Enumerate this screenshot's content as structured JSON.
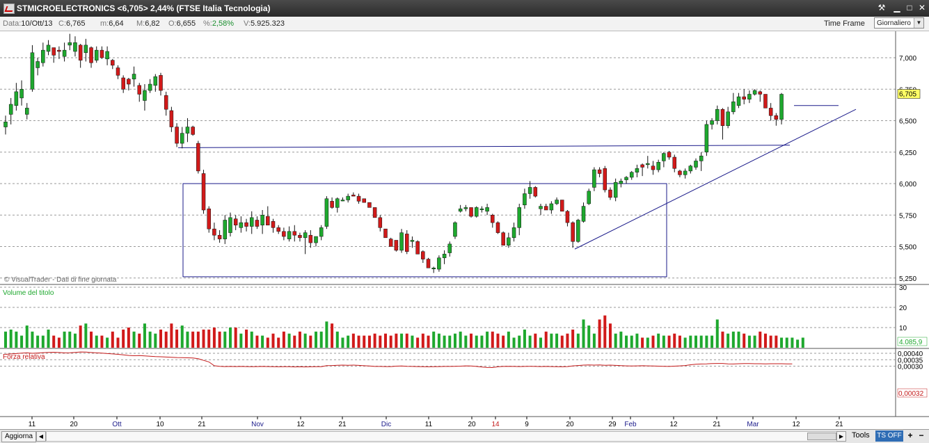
{
  "window": {
    "title": "STMICROELECTRONICS <6,705> 2,44%  (FTSE Italia Tecnologia)",
    "buttons": {
      "tools_glyph": "⚒",
      "min": "▁",
      "max": "□",
      "close": "✕"
    }
  },
  "quote": {
    "data_label": "Data:",
    "data_value": "10/Ott/13",
    "close_label": "C:",
    "close_value": "6,765",
    "min_label": "m:",
    "min_value": "6,64",
    "max_label": "M:",
    "max_value": "6,82",
    "open_label": "O:",
    "open_value": "6,655",
    "pct_label": "%:",
    "pct_value": "2,58%",
    "vol_label": "V:",
    "vol_value": "5.925.323"
  },
  "timeframe": {
    "label": "Time Frame",
    "selected": "Giornaliero"
  },
  "price_axis": [
    "7,000",
    "6,750",
    "6,500",
    "6,250",
    "6,000",
    "5,750",
    "5,500",
    "5,250"
  ],
  "current_price_tag": "6,705",
  "watermark": "© VisualTrader - Dati di fine giornata",
  "volume_panel": {
    "title": "Volume del titolo",
    "axis": [
      "30",
      "20",
      "10"
    ],
    "value_tag": "4.085,9"
  },
  "rs_panel": {
    "title": "Forza relativa",
    "axis": [
      "0,00040",
      "0,00035",
      "0,00030"
    ],
    "value_tag": "0,00032"
  },
  "time_axis": [
    {
      "label": "11",
      "month": false
    },
    {
      "label": "20",
      "month": false
    },
    {
      "label": "Ott",
      "month": true
    },
    {
      "label": "10",
      "month": false
    },
    {
      "label": "21",
      "month": false
    },
    {
      "label": "Nov",
      "month": true
    },
    {
      "label": "12",
      "month": false
    },
    {
      "label": "21",
      "month": false
    },
    {
      "label": "Dic",
      "month": true
    },
    {
      "label": "11",
      "month": false
    },
    {
      "label": "20",
      "month": false
    },
    {
      "label": "14",
      "month": "year"
    },
    {
      "label": "9",
      "month": false
    },
    {
      "label": "20",
      "month": false
    },
    {
      "label": "29",
      "month": false
    },
    {
      "label": "Feb",
      "month": true
    },
    {
      "label": "12",
      "month": false
    },
    {
      "label": "21",
      "month": false
    },
    {
      "label": "Mar",
      "month": true
    },
    {
      "label": "12",
      "month": false
    },
    {
      "label": "21",
      "month": false
    }
  ],
  "colors": {
    "up": "#1ea82e",
    "down": "#d11a1a",
    "line": "#1a1a8a",
    "rs": "#c41a1a",
    "axis": "#000000"
  },
  "bottom": {
    "aggiorna": "Aggiorna",
    "tools": "Tools",
    "ts": "TS OFF",
    "plus": "+",
    "minus": "−"
  },
  "chart_data": {
    "type": "candlestick",
    "ylim": [
      5.25,
      7.125
    ],
    "candles": [
      [
        6.45,
        6.39,
        6.49,
        6.54
      ],
      [
        6.55,
        6.47,
        6.63,
        6.68
      ],
      [
        6.62,
        6.58,
        6.73,
        6.8
      ],
      [
        6.68,
        6.62,
        6.75,
        6.82
      ],
      [
        6.55,
        6.51,
        6.6,
        6.64
      ],
      [
        6.75,
        6.73,
        7.04,
        7.1
      ],
      [
        6.92,
        6.86,
        6.97,
        7.0
      ],
      [
        6.96,
        6.93,
        7.06,
        7.12
      ],
      [
        7.05,
        7.02,
        7.1,
        7.14
      ],
      [
        7.08,
        6.96,
        7.02,
        7.05
      ],
      [
        7.06,
        6.99,
        7.05,
        7.09
      ],
      [
        7.01,
        6.97,
        7.06,
        7.12
      ],
      [
        7.1,
        7.06,
        7.12,
        7.19
      ],
      [
        7.05,
        7.01,
        7.12,
        7.17
      ],
      [
        7.1,
        6.92,
        6.98,
        7.11
      ],
      [
        7.04,
        6.97,
        7.1,
        7.15
      ],
      [
        7.08,
        6.92,
        6.96,
        7.09
      ],
      [
        6.98,
        6.96,
        7.06,
        7.09
      ],
      [
        7.06,
        6.99,
        7.0,
        7.09
      ],
      [
        6.99,
        6.94,
        7.05,
        7.09
      ],
      [
        6.98,
        6.91,
        6.94,
        6.99
      ],
      [
        6.92,
        6.83,
        6.86,
        6.94
      ],
      [
        6.84,
        6.72,
        6.75,
        6.86
      ],
      [
        6.83,
        6.74,
        6.79,
        6.84
      ],
      [
        6.83,
        6.77,
        6.87,
        6.93
      ],
      [
        6.78,
        6.65,
        6.71,
        6.8
      ],
      [
        6.66,
        6.58,
        6.74,
        6.79
      ],
      [
        6.74,
        6.72,
        6.79,
        6.83
      ],
      [
        6.78,
        6.73,
        6.85,
        6.87
      ],
      [
        6.86,
        6.7,
        6.74,
        6.88
      ],
      [
        6.7,
        6.54,
        6.59,
        6.73
      ],
      [
        6.58,
        6.41,
        6.45,
        6.61
      ],
      [
        6.45,
        6.29,
        6.32,
        6.48
      ],
      [
        6.32,
        6.28,
        6.4,
        6.45
      ],
      [
        6.4,
        6.33,
        6.45,
        6.52
      ],
      [
        6.45,
        6.38,
        6.39,
        6.46
      ],
      [
        6.32,
        6.08,
        6.1,
        6.34
      ],
      [
        6.08,
        5.76,
        5.79,
        6.11
      ],
      [
        5.8,
        5.61,
        5.64,
        5.82
      ],
      [
        5.64,
        5.55,
        5.59,
        5.69
      ],
      [
        5.59,
        5.53,
        5.56,
        5.63
      ],
      [
        5.56,
        5.52,
        5.71,
        5.75
      ],
      [
        5.61,
        5.58,
        5.73,
        5.77
      ],
      [
        5.72,
        5.63,
        5.67,
        5.75
      ],
      [
        5.65,
        5.61,
        5.69,
        5.74
      ],
      [
        5.69,
        5.62,
        5.66,
        5.72
      ],
      [
        5.66,
        5.6,
        5.73,
        5.78
      ],
      [
        5.71,
        5.64,
        5.66,
        5.74
      ],
      [
        5.67,
        5.6,
        5.75,
        5.79
      ],
      [
        5.74,
        5.67,
        5.67,
        5.82
      ],
      [
        5.7,
        5.61,
        5.65,
        5.72
      ],
      [
        5.65,
        5.6,
        5.62,
        5.67
      ],
      [
        5.62,
        5.55,
        5.58,
        5.65
      ],
      [
        5.56,
        5.54,
        5.62,
        5.66
      ],
      [
        5.62,
        5.54,
        5.59,
        5.67
      ],
      [
        5.59,
        5.54,
        5.57,
        5.61
      ],
      [
        5.57,
        5.44,
        5.61,
        5.63
      ],
      [
        5.59,
        5.49,
        5.53,
        5.63
      ],
      [
        5.53,
        5.5,
        5.58,
        5.58
      ],
      [
        5.58,
        5.55,
        5.65,
        5.67
      ],
      [
        5.66,
        5.64,
        5.88,
        5.9
      ],
      [
        5.86,
        5.8,
        5.81,
        5.89
      ],
      [
        5.81,
        5.77,
        5.88,
        5.89
      ],
      [
        5.87,
        5.86,
        5.87,
        5.89
      ],
      [
        5.87,
        5.85,
        5.9,
        5.92
      ],
      [
        5.91,
        5.9,
        5.9,
        5.93
      ],
      [
        5.9,
        5.84,
        5.86,
        5.92
      ],
      [
        5.88,
        5.85,
        5.85,
        5.88
      ],
      [
        5.85,
        5.82,
        5.81,
        5.85
      ],
      [
        5.81,
        5.73,
        5.73,
        5.81
      ],
      [
        5.73,
        5.62,
        5.65,
        5.75
      ],
      [
        5.64,
        5.59,
        5.57,
        5.64
      ],
      [
        5.56,
        5.51,
        5.5,
        5.57
      ],
      [
        5.55,
        5.46,
        5.47,
        5.55
      ],
      [
        5.47,
        5.45,
        5.61,
        5.64
      ],
      [
        5.6,
        5.44,
        5.46,
        5.63
      ],
      [
        5.54,
        5.49,
        5.55,
        5.58
      ],
      [
        5.54,
        5.44,
        5.44,
        5.55
      ],
      [
        5.46,
        5.37,
        5.4,
        5.47
      ],
      [
        5.4,
        5.33,
        5.33,
        5.41
      ],
      [
        5.33,
        5.29,
        5.33,
        5.34
      ],
      [
        5.32,
        5.3,
        5.41,
        5.43
      ],
      [
        5.41,
        5.36,
        5.44,
        5.47
      ],
      [
        5.45,
        5.42,
        5.52,
        5.54
      ],
      [
        5.58,
        5.56,
        5.69,
        5.7
      ],
      [
        5.78,
        5.77,
        5.8,
        5.83
      ],
      [
        5.8,
        5.78,
        5.81,
        5.83
      ],
      [
        5.81,
        5.73,
        5.74,
        5.81
      ],
      [
        5.74,
        5.73,
        5.81,
        5.82
      ],
      [
        5.8,
        5.77,
        5.8,
        5.82
      ],
      [
        5.78,
        5.75,
        5.81,
        5.84
      ],
      [
        5.75,
        5.65,
        5.69,
        5.76
      ],
      [
        5.69,
        5.6,
        5.61,
        5.7
      ],
      [
        5.61,
        5.53,
        5.51,
        5.62
      ],
      [
        5.51,
        5.49,
        5.57,
        5.61
      ],
      [
        5.57,
        5.54,
        5.65,
        5.69
      ],
      [
        5.65,
        5.59,
        5.81,
        5.84
      ],
      [
        5.83,
        5.8,
        5.92,
        5.96
      ],
      [
        5.92,
        5.88,
        5.97,
        6.02
      ],
      [
        5.97,
        5.89,
        5.9,
        5.98
      ],
      [
        5.8,
        5.75,
        5.82,
        5.84
      ],
      [
        5.82,
        5.79,
        5.79,
        5.84
      ],
      [
        5.79,
        5.76,
        5.84,
        5.86
      ],
      [
        5.84,
        5.83,
        5.87,
        5.89
      ],
      [
        5.87,
        5.81,
        5.78,
        5.87
      ],
      [
        5.78,
        5.66,
        5.69,
        5.79
      ],
      [
        5.69,
        5.49,
        5.54,
        5.7
      ],
      [
        5.54,
        5.53,
        5.71,
        5.72
      ],
      [
        5.7,
        5.69,
        5.82,
        5.85
      ],
      [
        5.84,
        5.83,
        5.94,
        5.96
      ],
      [
        5.97,
        5.94,
        6.11,
        6.13
      ],
      [
        6.11,
        6.05,
        6.08,
        6.13
      ],
      [
        6.12,
        5.93,
        5.95,
        6.14
      ],
      [
        5.95,
        5.87,
        5.89,
        5.97
      ],
      [
        5.89,
        5.86,
        6.01,
        6.04
      ],
      [
        6.0,
        5.97,
        6.02,
        6.04
      ],
      [
        6.03,
        6.0,
        6.05,
        6.06
      ],
      [
        6.05,
        6.03,
        6.09,
        6.1
      ],
      [
        6.09,
        6.05,
        6.12,
        6.15
      ],
      [
        6.15,
        6.06,
        6.13,
        6.16
      ],
      [
        6.15,
        6.12,
        6.16,
        6.22
      ],
      [
        6.14,
        6.07,
        6.11,
        6.18
      ],
      [
        6.11,
        6.09,
        6.17,
        6.19
      ],
      [
        6.18,
        6.13,
        6.24,
        6.25
      ],
      [
        6.25,
        6.19,
        6.21,
        6.26
      ],
      [
        6.21,
        6.09,
        6.12,
        6.23
      ],
      [
        6.1,
        6.05,
        6.07,
        6.11
      ],
      [
        6.07,
        6.04,
        6.1,
        6.12
      ],
      [
        6.1,
        6.08,
        6.14,
        6.15
      ],
      [
        6.13,
        6.11,
        6.18,
        6.2
      ],
      [
        6.18,
        6.1,
        6.22,
        6.25
      ],
      [
        6.25,
        6.22,
        6.47,
        6.5
      ],
      [
        6.47,
        6.43,
        6.5,
        6.52
      ],
      [
        6.5,
        6.47,
        6.59,
        6.62
      ],
      [
        6.59,
        6.35,
        6.46,
        6.6
      ],
      [
        6.46,
        6.44,
        6.57,
        6.61
      ],
      [
        6.57,
        6.55,
        6.65,
        6.72
      ],
      [
        6.62,
        6.6,
        6.69,
        6.72
      ],
      [
        6.69,
        6.63,
        6.67,
        6.75
      ],
      [
        6.67,
        6.64,
        6.71,
        6.74
      ],
      [
        6.71,
        6.7,
        6.74,
        6.75
      ],
      [
        6.73,
        6.65,
        6.71,
        6.74
      ],
      [
        6.71,
        6.6,
        6.6,
        6.71
      ],
      [
        6.6,
        6.5,
        6.54,
        6.64
      ],
      [
        6.54,
        6.46,
        6.51,
        6.56
      ],
      [
        6.51,
        6.47,
        6.71,
        6.72
      ]
    ],
    "volume": [
      8,
      9,
      8,
      6,
      11,
      8,
      6,
      6,
      9,
      6,
      5,
      8,
      8,
      7,
      11,
      12,
      8,
      6,
      6,
      5,
      8,
      5,
      9,
      10,
      8,
      7,
      12,
      8,
      7,
      9,
      8,
      12,
      9,
      11,
      8,
      8,
      8,
      9,
      9,
      10,
      8,
      8,
      10,
      10,
      7,
      9,
      8,
      6,
      6,
      5,
      7,
      5,
      8,
      7,
      6,
      8,
      7,
      6,
      8,
      8,
      13,
      12,
      8,
      5,
      6,
      7,
      6,
      6,
      6,
      7,
      6,
      7,
      6,
      7,
      7,
      7,
      6,
      5,
      7,
      6,
      8,
      7,
      6,
      6,
      7,
      8,
      6,
      7,
      6,
      6,
      8,
      8,
      7,
      6,
      8,
      5,
      6,
      9,
      6,
      7,
      5,
      8,
      7,
      7,
      6,
      7,
      9,
      7,
      14,
      11,
      7,
      14,
      16,
      12,
      7,
      8,
      6,
      6,
      7,
      5,
      5,
      6,
      7,
      6,
      6,
      7,
      6,
      5,
      6,
      6,
      6,
      6,
      6,
      14,
      8,
      7,
      8,
      8,
      7,
      6,
      6,
      8,
      7,
      6,
      6,
      5,
      5,
      5,
      4,
      5
    ],
    "rs": [
      0.000392,
      0.000395,
      0.000398,
      0.000401,
      0.000403,
      0.0004,
      0.000402,
      0.000405,
      0.000407,
      0.000408,
      0.000406,
      0.000403,
      0.000404,
      0.000407,
      0.00041,
      0.000409,
      0.000406,
      0.000403,
      0.000401,
      0.000398,
      0.000395,
      0.000392,
      0.000388,
      0.000383,
      0.000381,
      0.000382,
      0.00038,
      0.000377,
      0.000374,
      0.000373,
      0.000371,
      0.000369,
      0.000367,
      0.000366,
      0.000365,
      0.000364,
      0.000358,
      0.000345,
      0.000333,
      0.000303,
      0.000299,
      0.000297,
      0.000298,
      0.000297,
      0.000298,
      0.000297,
      0.000296,
      0.000297,
      0.000298,
      0.000297,
      0.000296,
      0.000295,
      0.000296,
      0.000296,
      0.000294,
      0.000295,
      0.000294,
      0.000295,
      0.000296,
      0.000296,
      0.000304,
      0.000305,
      0.000307,
      0.000308,
      0.000307,
      0.000308,
      0.000306,
      0.000303,
      0.000301,
      0.000298,
      0.000298,
      0.000297,
      0.000297,
      0.0003,
      0.000301,
      0.000299,
      0.000298,
      0.000297,
      0.000296,
      0.000295,
      0.000296,
      0.000297,
      0.000298,
      0.000298,
      0.000299,
      0.0003,
      0.000302,
      0.000301,
      0.000298,
      0.000293,
      0.00029,
      0.000289,
      0.000295,
      0.000298,
      0.000299,
      0.000298,
      0.000297,
      0.000298,
      0.000299,
      0.000298,
      0.000297,
      0.000298,
      0.000297,
      0.000296,
      0.000295,
      0.000297,
      0.000302,
      0.000305,
      0.000308,
      0.000309,
      0.000308,
      0.000309,
      0.000307,
      0.000308,
      0.000306,
      0.000304,
      0.000302,
      0.000301,
      0.000302,
      0.000303,
      0.000302,
      0.000301,
      0.0003,
      0.000299,
      0.000298,
      0.0003,
      0.000302,
      0.000305,
      0.000311,
      0.000315,
      0.000317,
      0.000318,
      0.00032,
      0.000321,
      0.000321,
      0.000318,
      0.000317,
      0.000319,
      0.00032,
      0.00032,
      0.000319,
      0.000319,
      0.000318,
      0.000319,
      0.000319,
      0.000319,
      0.000318,
      0.000318
    ]
  }
}
